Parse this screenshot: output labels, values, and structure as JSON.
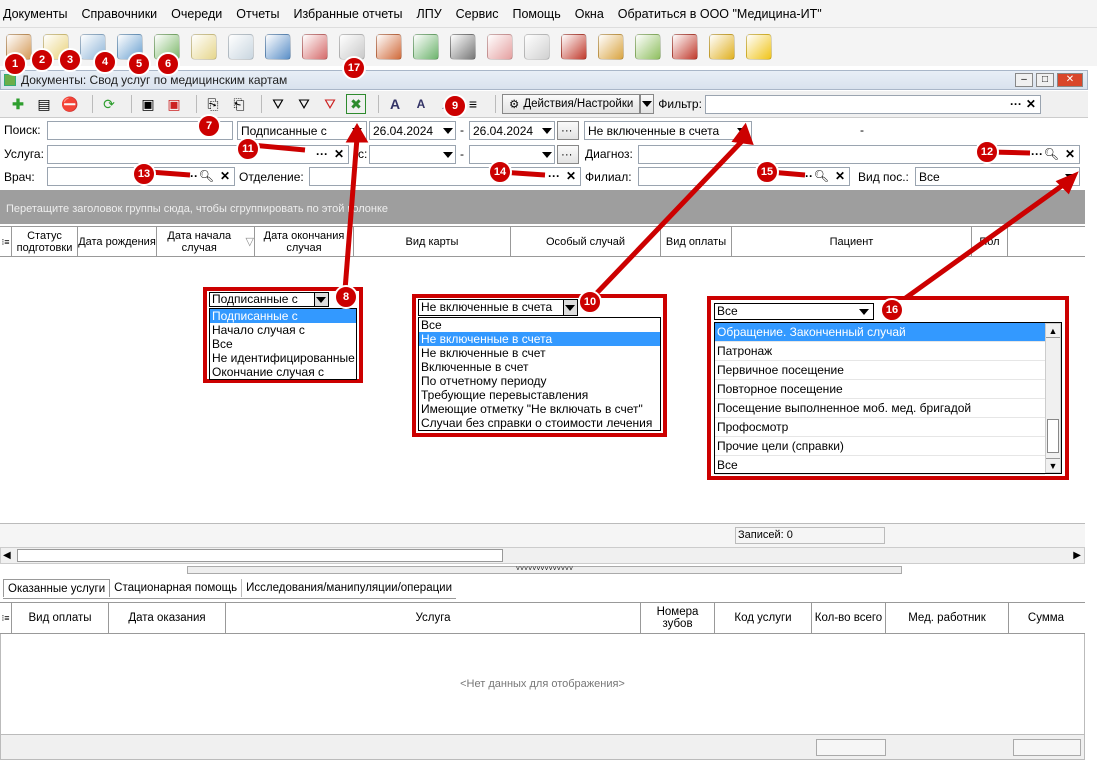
{
  "menu": [
    "Документы",
    "Справочники",
    "Очереди",
    "Отчеты",
    "Избранные отчеты",
    "ЛПУ",
    "Сервис",
    "Помощь",
    "Окна",
    "Обратиться в ООО \"Медицина-ИТ\""
  ],
  "big_icons": [
    {
      "name": "doctor-icon",
      "color": "#d49a57"
    },
    {
      "name": "journal-icon",
      "color": "#e9d27a"
    },
    {
      "name": "register-icon",
      "color": "#8fb5d8"
    },
    {
      "name": "card-icon",
      "color": "#6aa0d0"
    },
    {
      "name": "lab-icon",
      "color": "#7db86a"
    },
    {
      "name": "notepad-icon",
      "color": "#e6d68c"
    },
    {
      "name": "syringe-icon",
      "color": "#c9d6e0"
    },
    {
      "name": "calendar-icon",
      "color": "#5a8fc7"
    },
    {
      "name": "medkit-icon",
      "color": "#d56a6a"
    },
    {
      "name": "box-icon",
      "color": "#c9c9c9"
    },
    {
      "name": "books-icon",
      "color": "#d06a3a"
    },
    {
      "name": "pills-icon",
      "color": "#6cb36c"
    },
    {
      "name": "scanner-icon",
      "color": "#777777"
    },
    {
      "name": "nurse-icon",
      "color": "#e5a0a0"
    },
    {
      "name": "thermometer-icon",
      "color": "#d0d0d0"
    },
    {
      "name": "folder-icon",
      "color": "#c0392b"
    },
    {
      "name": "gear-page-icon",
      "color": "#d9a441"
    },
    {
      "name": "certificate-icon",
      "color": "#8fbf5f"
    },
    {
      "name": "export-icon",
      "color": "#c0392b"
    },
    {
      "name": "lock-icon",
      "color": "#e0b020"
    },
    {
      "name": "chat-icon",
      "color": "#f0c419"
    }
  ],
  "window": {
    "title": "Документы: Свод услуг по медицинским картам"
  },
  "toolbar": {
    "actions_label": "Действия/Настройки",
    "filter_label": "Фильтр:",
    "filter_value": ""
  },
  "filters": {
    "search_label": "Поиск:",
    "search_value": "",
    "signed_value": "Подписанные с",
    "date_from": "26.04.2024",
    "dash": "-",
    "date_to": "26.04.2024",
    "invoice_value": "Не включенные в счета",
    "extra_dash": "-",
    "service_label": "Услуга:",
    "service_value": "",
    "c_label": "с:",
    "c_value": "",
    "c_to": "",
    "diagnosis_label": "Диагноз:",
    "diagnosis_value": "",
    "doctor_label": "Врач:",
    "doctor_value": "",
    "dept_label": "Отделение:",
    "dept_value": "",
    "branch_label": "Филиал:",
    "branch_value": "",
    "visit_label": "Вид пос.:",
    "visit_value": "Все"
  },
  "group_hint": "Перетащите заголовок группы сюда, чтобы сгруппировать по этой колонке",
  "columns": [
    "Статус подготовки",
    "Дата рождения",
    "Дата начала случая",
    "Дата окончания случая",
    "Вид карты",
    "Особый случай",
    "Вид оплаты",
    "Пациент",
    "Пол"
  ],
  "dropdown_signed": {
    "value": "Подписанные с",
    "options": [
      "Подписанные с",
      "Начало случая с",
      "Все",
      "Не идентифицированные",
      "Окончание случая с"
    ],
    "selected": 0
  },
  "dropdown_invoice": {
    "value": "Не включенные в счета",
    "options": [
      "Все",
      "Не включенные в счета",
      "Не включенные в счет",
      "Включенные в счет",
      "По отчетному периоду",
      "Требующие перевыставления",
      "Имеющие отметку \"Не включать в счет\"",
      "Случаи без справки о стоимости лечения"
    ],
    "selected": 1
  },
  "dropdown_visit": {
    "value": "Все",
    "options": [
      "Обращение. Законченный случай",
      "Патронаж",
      "Первичное посещение",
      "Повторное посещение",
      "Посещение выполненное моб. мед. бригадой",
      "Профосмотр",
      "Прочие цели (справки)",
      "Все"
    ],
    "selected": 0
  },
  "badges": [
    "1",
    "2",
    "3",
    "4",
    "5",
    "6",
    "7",
    "8",
    "9",
    "10",
    "11",
    "12",
    "13",
    "14",
    "15",
    "16",
    "17"
  ],
  "records": "Записей: 0",
  "tabs": [
    "Оказанные услуги",
    "Стационарная помощь",
    "Исследования/манипуляции/операции"
  ],
  "lower_columns": [
    "Вид оплаты",
    "Дата оказания",
    "Услуга",
    "Номера зубов",
    "Код услуги",
    "Кол-во всего",
    "Мед. работник",
    "Сумма"
  ],
  "no_data": "<Нет данных для отображения>",
  "accent": "#cc0000"
}
